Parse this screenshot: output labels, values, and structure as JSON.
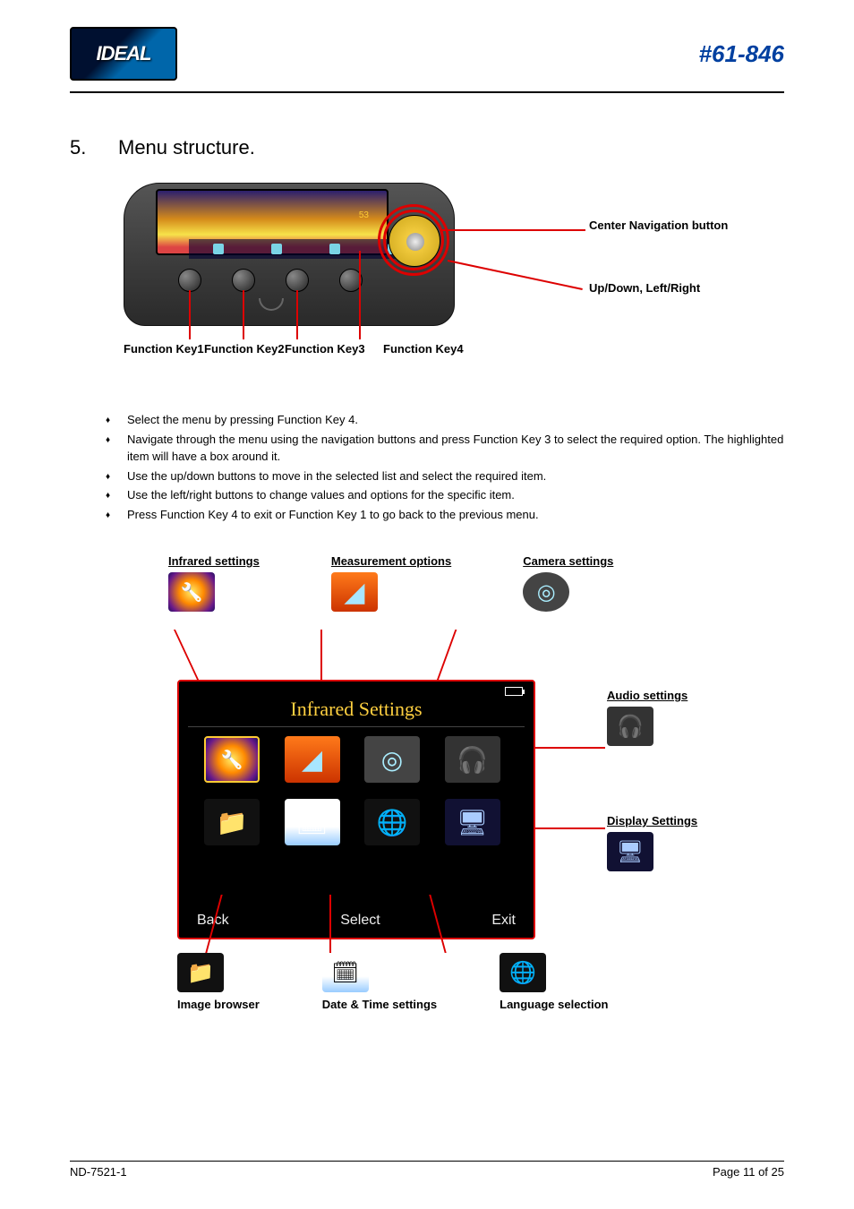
{
  "header": {
    "model": "#61-846",
    "logo_text": "IDEAL"
  },
  "section": {
    "number": "5.",
    "title": "Menu structure."
  },
  "device_labels": {
    "fn1": "Function Key1",
    "fn2": "Function Key2",
    "fn3": "Function Key3",
    "fn4": "Function Key4",
    "center_nav": "Center Navigation button",
    "updown": "Up/Down, Left/Right"
  },
  "bullets": [
    "Select the menu by pressing Function Key 4.",
    "Navigate through the menu using the navigation buttons and press Function Key 3 to select the required option. The highlighted item will have a box around it.",
    "Use the up/down buttons to move in the selected list and select the required item.",
    "Use the left/right buttons to change values and options for the specific item.",
    "Press Function Key 4 to exit or Function Key 1 to go back to the previous menu."
  ],
  "menu_labels": {
    "infrared": "Infrared settings",
    "measurement": "Measurement options",
    "camera": "Camera settings",
    "audio": "Audio settings",
    "display": "Display Settings",
    "image_browser": "Image browser",
    "datetime": "Date & Time settings",
    "language": "Language selection"
  },
  "screen": {
    "title": "Infrared Settings",
    "back": "Back",
    "select": "Select",
    "exit": "Exit"
  },
  "footer": {
    "doc": "ND-7521-1",
    "page": "Page 11 of 25"
  }
}
